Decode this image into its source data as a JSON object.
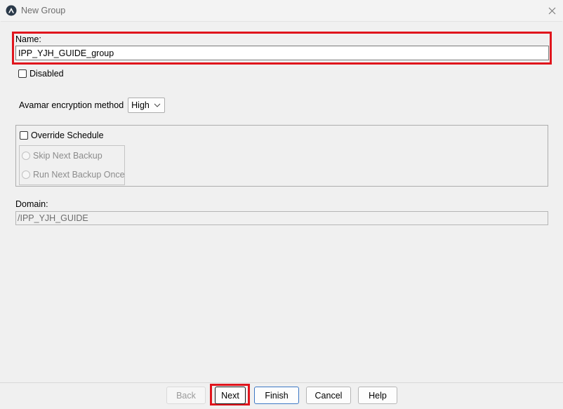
{
  "window": {
    "title": "New Group",
    "app_icon": "avamar-logo-icon",
    "close_icon": "close-icon"
  },
  "form": {
    "name_label": "Name:",
    "name_value": "IPP_YJH_GUIDE_group",
    "disabled_label": "Disabled",
    "disabled_checked": false,
    "encryption_label": "Avamar encryption method",
    "encryption_value": "High",
    "override_label": "Override Schedule",
    "override_checked": false,
    "radio_options": [
      {
        "label": "Skip Next Backup",
        "enabled": false
      },
      {
        "label": "Run Next Backup Once",
        "enabled": false
      }
    ],
    "domain_label": "Domain:",
    "domain_value": "/IPP_YJH_GUIDE"
  },
  "buttons": {
    "back": "Back",
    "next": "Next",
    "finish": "Finish",
    "cancel": "Cancel",
    "help": "Help"
  },
  "colors": {
    "highlight": "#e0151d",
    "default_button_border": "#3c78c4"
  }
}
